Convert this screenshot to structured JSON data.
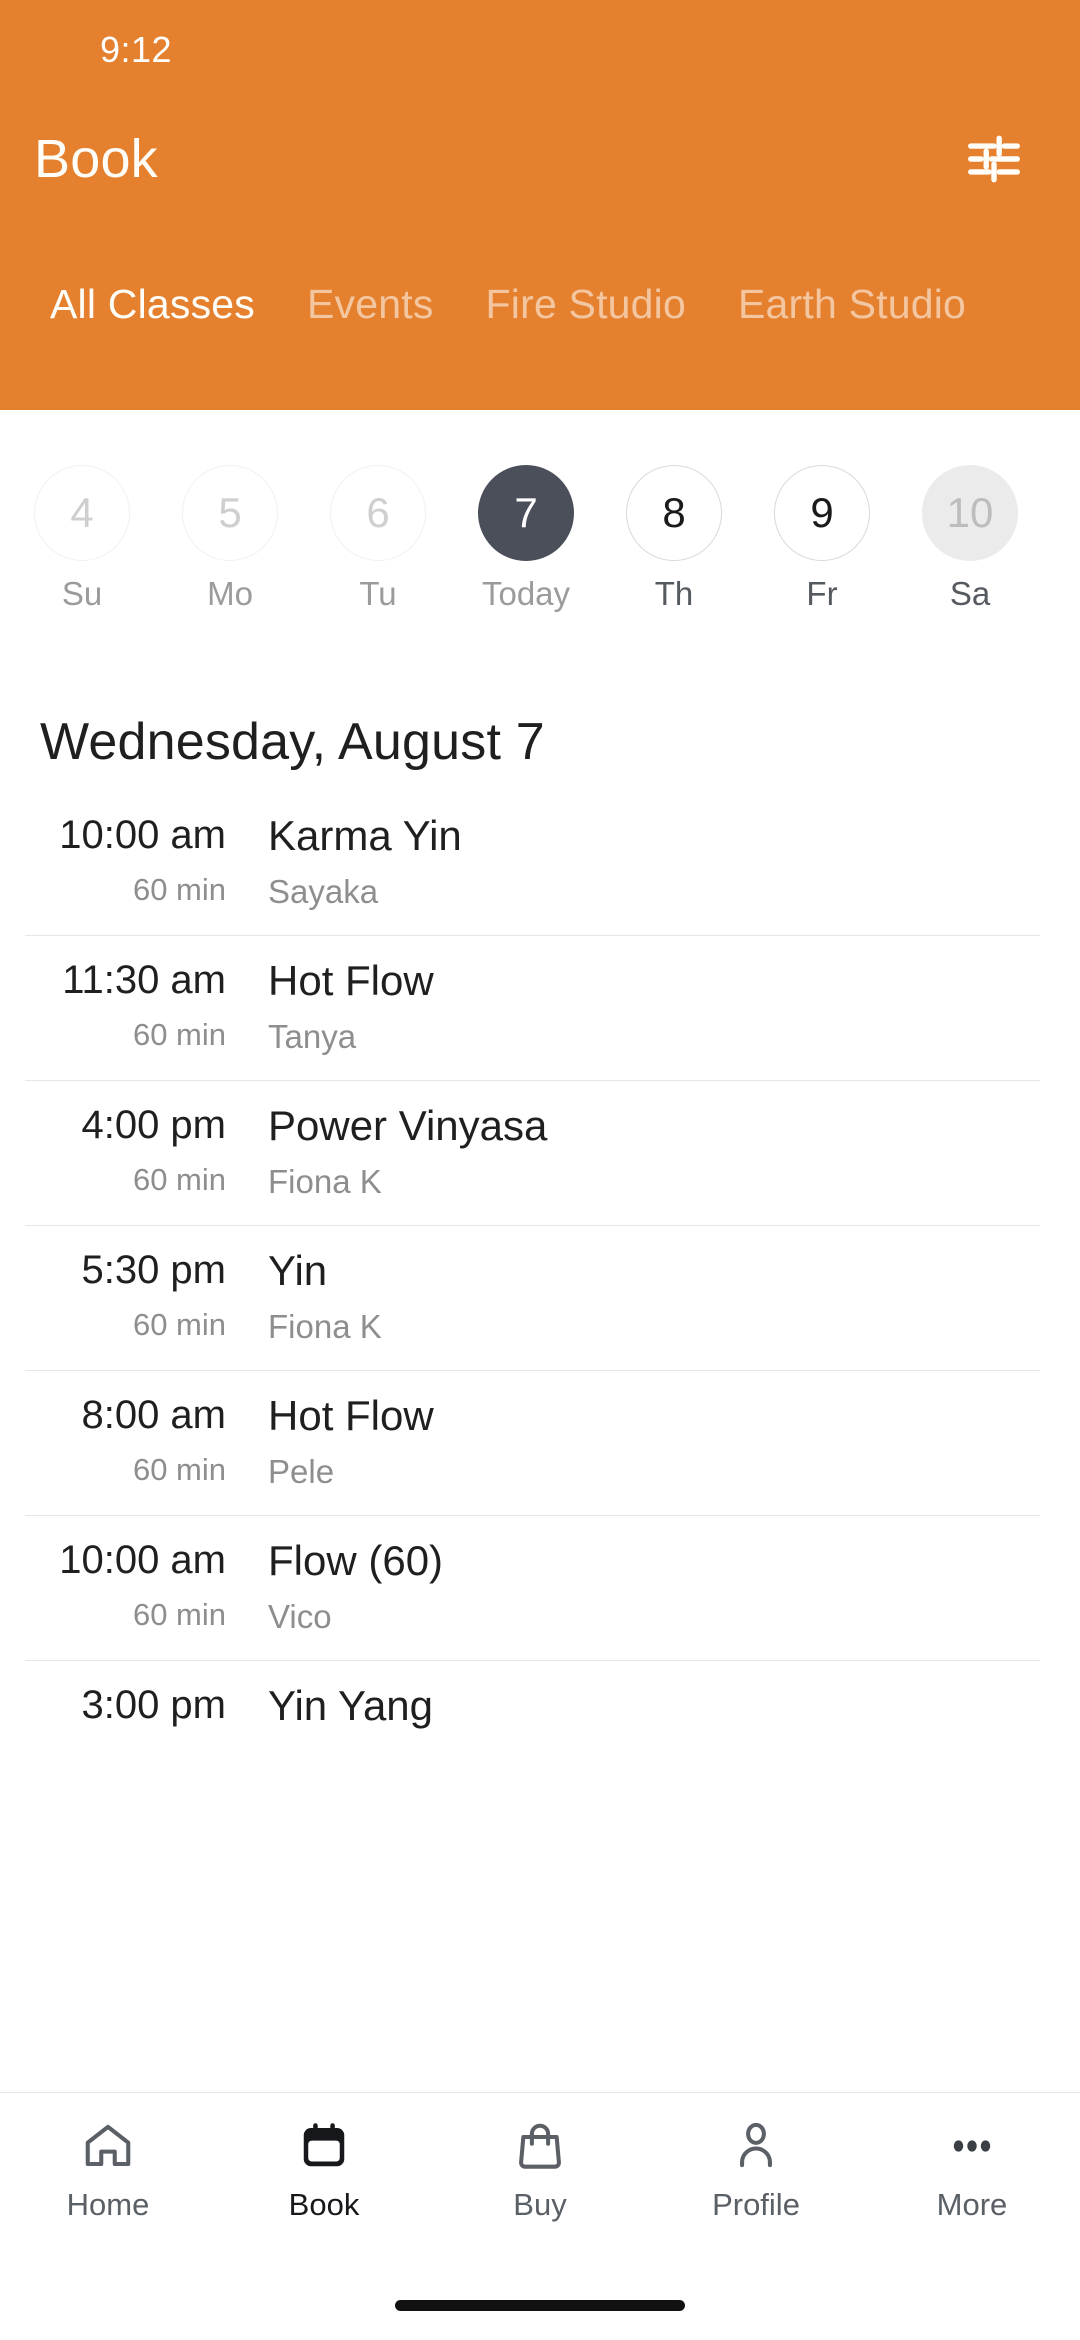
{
  "theme": {
    "accent": "#e5802e",
    "selected_day": "#4a4f5a",
    "text_primary": "#1f1f1f",
    "text_muted": "#8e8e8e"
  },
  "status_bar": {
    "time": "9:12"
  },
  "header": {
    "title": "Book",
    "filter_icon": "tune-icon",
    "tabs": [
      {
        "label": "All Classes",
        "active": true
      },
      {
        "label": "Events",
        "active": false
      },
      {
        "label": "Fire Studio",
        "active": false
      },
      {
        "label": "Earth Studio",
        "active": false
      }
    ]
  },
  "date_strip": [
    {
      "day": "4",
      "weekday": "Su",
      "state": "past"
    },
    {
      "day": "5",
      "weekday": "Mo",
      "state": "past"
    },
    {
      "day": "6",
      "weekday": "Tu",
      "state": "past"
    },
    {
      "day": "7",
      "weekday": "Today",
      "state": "today"
    },
    {
      "day": "8",
      "weekday": "Th",
      "state": "future"
    },
    {
      "day": "9",
      "weekday": "Fr",
      "state": "future"
    },
    {
      "day": "10",
      "weekday": "Sa",
      "state": "pressed"
    }
  ],
  "schedule": {
    "day_heading": "Wednesday, August 7",
    "classes": [
      {
        "time": "10:00 am",
        "duration": "60 min",
        "name": "Karma Yin",
        "teacher": "Sayaka"
      },
      {
        "time": "11:30 am",
        "duration": "60 min",
        "name": "Hot Flow",
        "teacher": "Tanya"
      },
      {
        "time": "4:00 pm",
        "duration": "60 min",
        "name": "Power Vinyasa",
        "teacher": "Fiona K"
      },
      {
        "time": "5:30 pm",
        "duration": "60 min",
        "name": "Yin",
        "teacher": "Fiona K"
      },
      {
        "time": "8:00 am",
        "duration": "60 min",
        "name": "Hot Flow",
        "teacher": "Pele"
      },
      {
        "time": "10:00 am",
        "duration": "60 min",
        "name": "Flow (60)",
        "teacher": "Vico"
      },
      {
        "time": "3:00 pm",
        "duration": "",
        "name": "Yin Yang",
        "teacher": ""
      }
    ]
  },
  "bottom_nav": [
    {
      "label": "Home",
      "icon": "house-icon",
      "active": false
    },
    {
      "label": "Book",
      "icon": "calendar-icon",
      "active": true
    },
    {
      "label": "Buy",
      "icon": "shopping-bag-icon",
      "active": false
    },
    {
      "label": "Profile",
      "icon": "person-icon",
      "active": false
    },
    {
      "label": "More",
      "icon": "ellipsis-icon",
      "active": false
    }
  ]
}
